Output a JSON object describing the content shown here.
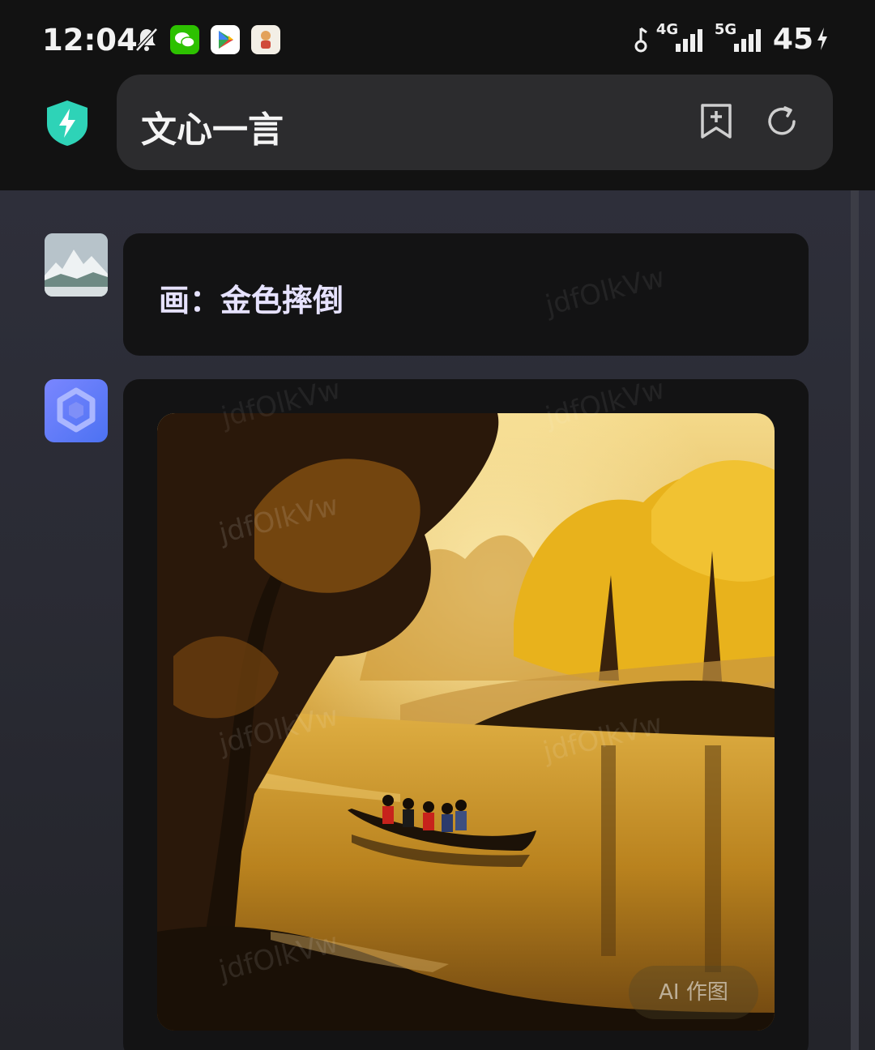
{
  "status_bar": {
    "time": "12:04",
    "network_1": "4G",
    "network_2": "5G",
    "battery": "45"
  },
  "header": {
    "title": "文心一言",
    "icons": [
      "shield-bolt-icon",
      "bookmark-add-icon",
      "refresh-icon"
    ]
  },
  "chat": {
    "messages": [
      {
        "role": "user",
        "text": "画：金色摔倒"
      },
      {
        "role": "bot",
        "type": "image",
        "badge": "AI 作图"
      }
    ],
    "watermark": "jdfOlkVw"
  },
  "colors": {
    "accent_shield": "#2ed3b7",
    "bot_avatar": "#5b7cf5",
    "bubble_bg": "#131314"
  }
}
